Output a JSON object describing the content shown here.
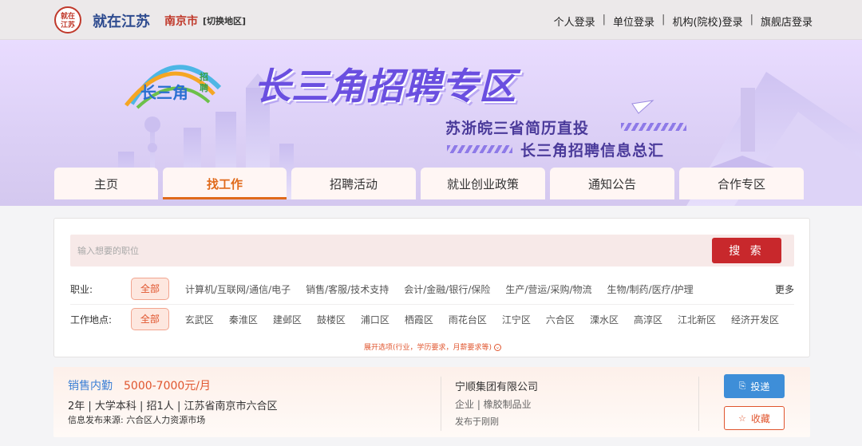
{
  "topbar": {
    "logo_text": "就在江苏",
    "site_name": "就在江苏",
    "city": "南京市",
    "switch_region": "[切换地区]",
    "login_links": [
      "个人登录",
      "单位登录",
      "机构(院校)登录",
      "旗舰店登录"
    ]
  },
  "banner": {
    "ribbon_logo_text": "长三角",
    "ribbon_logo_small": "招聘",
    "title": "长三角招聘专区",
    "subtitle_1": "苏浙皖三省简历直投",
    "subtitle_2": "长三角招聘信息总汇"
  },
  "nav": {
    "tabs": [
      "主页",
      "找工作",
      "招聘活动",
      "就业创业政策",
      "通知公告",
      "合作专区"
    ],
    "active_index": 1
  },
  "search": {
    "placeholder": "输入想要的职位",
    "button_label": "搜 索"
  },
  "filters": {
    "occupation": {
      "label": "职业:",
      "all_label": "全部",
      "options": [
        "计算机/互联网/通信/电子",
        "销售/客服/技术支持",
        "会计/金融/银行/保险",
        "生产/营运/采购/物流",
        "生物/制药/医疗/护理"
      ],
      "more_label": "更多"
    },
    "location": {
      "label": "工作地点:",
      "all_label": "全部",
      "options": [
        "玄武区",
        "秦淮区",
        "建邺区",
        "鼓楼区",
        "浦口区",
        "栖霞区",
        "雨花台区",
        "江宁区",
        "六合区",
        "溧水区",
        "高淳区",
        "江北新区",
        "经济开发区"
      ]
    },
    "expand_label": "展开选项(行业，学历要求，月薪要求等)"
  },
  "job": {
    "title": "销售内勤",
    "salary": "5000-7000元/月",
    "requirements": "2年 | 大学本科 | 招1人 | 江苏省南京市六合区",
    "source": "信息发布来源: 六合区人力资源市场",
    "company": "宁顺集团有限公司",
    "industry": "企业 | 橡胶制品业",
    "posted": "发布于刚刚",
    "apply_label": "投递",
    "favorite_label": "收藏"
  },
  "colors": {
    "accent": "#e06a1b",
    "primary_red": "#c8282c",
    "link_blue": "#3a7fd5",
    "apply_blue": "#3e8ed8"
  }
}
